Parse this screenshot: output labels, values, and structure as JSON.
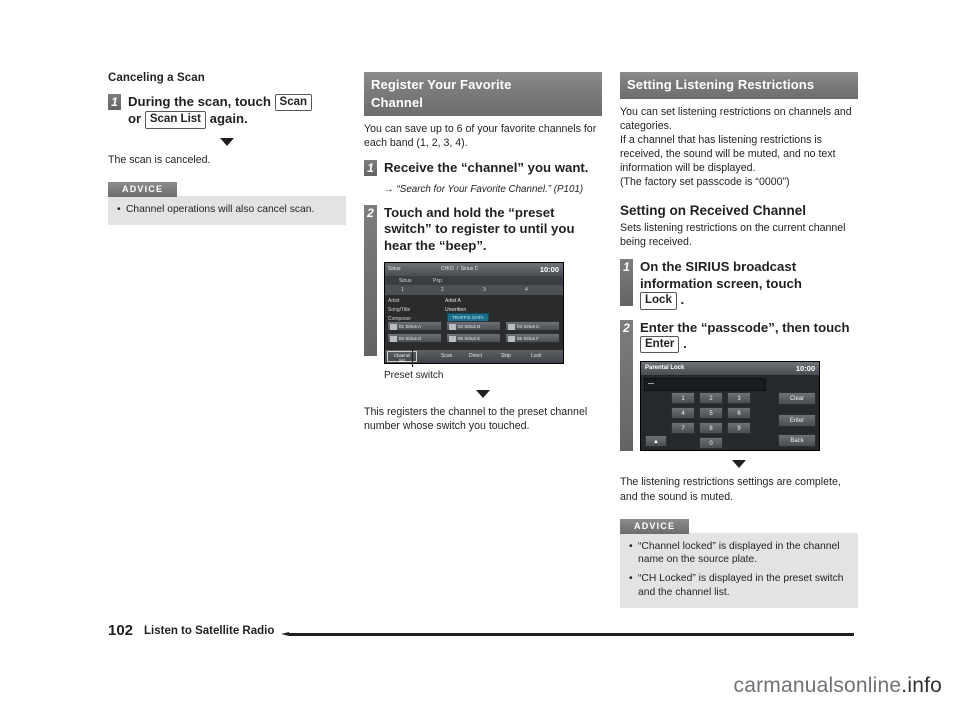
{
  "page": {
    "number": "102",
    "title": "Listen to Satellite Radio",
    "watermark_main": "carmanualsonline",
    "watermark_suffix": ".info"
  },
  "column_1": {
    "heading": "Canceling a Scan",
    "step1": {
      "num": "1",
      "text_a": "During the scan, touch",
      "key_a": "Scan",
      "text_b": "or",
      "key_b": "Scan List",
      "text_c": "again."
    },
    "result": "The scan is canceled.",
    "advice": {
      "label": "ADVICE",
      "items": [
        "Channel operations will also cancel scan."
      ]
    }
  },
  "column_2": {
    "heading_line1": "Register Your Favorite",
    "heading_line2": "Channel",
    "intro": "You can save up to 6 of your favorite channels for each band (1, 2, 3, 4).",
    "step1": {
      "num": "1",
      "title": "Receive the “channel” you want.",
      "ref_arrow": "→",
      "ref": "“Search for Your Favorite Channel.” (P101)"
    },
    "step2": {
      "num": "2",
      "title": "Touch and hold the “preset switch” to register to until you hear the “beep”."
    },
    "callout": "Preset switch",
    "result": "This registers the channel to the preset channel number whose switch you touched.",
    "screen": {
      "clock": "10:00",
      "top_left": "Sirius",
      "top_mid_1": "CH03",
      "top_mid_2": "Sirius C",
      "band_left": "Sirius",
      "band_right": "Pop",
      "preset_numbers": [
        "1",
        "2",
        "3",
        "4"
      ],
      "info_labels": [
        "Artist",
        "Song/Title",
        "Composer"
      ],
      "info_values": [
        "Artist A",
        "Unwritten"
      ],
      "pill": "TRAFFIC DATA",
      "channels": [
        "01 Sirius A",
        "02 Sirius B",
        "03 Sirius C",
        "04 Sirius D",
        "05 Sirius E",
        "06 Sirius F"
      ],
      "bottom_left_1": "Channel",
      "bottom_left_2": "list",
      "bottom_buttons": [
        "Scan",
        "Direct",
        "Skip",
        "Lock"
      ]
    }
  },
  "column_3": {
    "heading": "Setting Listening Restrictions",
    "intro_lines": [
      "You can set listening restrictions on channels and categories.",
      "If a channel that has listening restrictions is received, the sound will be muted, and no text information will be displayed.",
      "(The factory set passcode is “0000”)"
    ],
    "sub_heading": "Setting on Received Channel",
    "sub_intro": "Sets listening restrictions on the current channel being received.",
    "step1": {
      "num": "1",
      "text_a": "On the SIRIUS broadcast information screen, touch",
      "key": "Lock",
      "text_b": "."
    },
    "step2": {
      "num": "2",
      "text_a": "Enter the “passcode”, then touch",
      "key": "Enter",
      "text_b": "."
    },
    "result": "The listening restrictions settings are complete, and the sound is muted.",
    "advice": {
      "label": "ADVICE",
      "items": [
        "“Channel locked” is displayed in the channel name on the source plate.",
        "“CH Locked” is displayed in the preset switch and the channel list."
      ]
    },
    "screen": {
      "title": "Parental Lock",
      "clock": "10:00",
      "keys": [
        "1",
        "2",
        "3",
        "4",
        "5",
        "6",
        "7",
        "8",
        "9",
        "0"
      ],
      "side_buttons": [
        "Clear",
        "Enter",
        "Back"
      ],
      "arrow": "▲"
    }
  }
}
